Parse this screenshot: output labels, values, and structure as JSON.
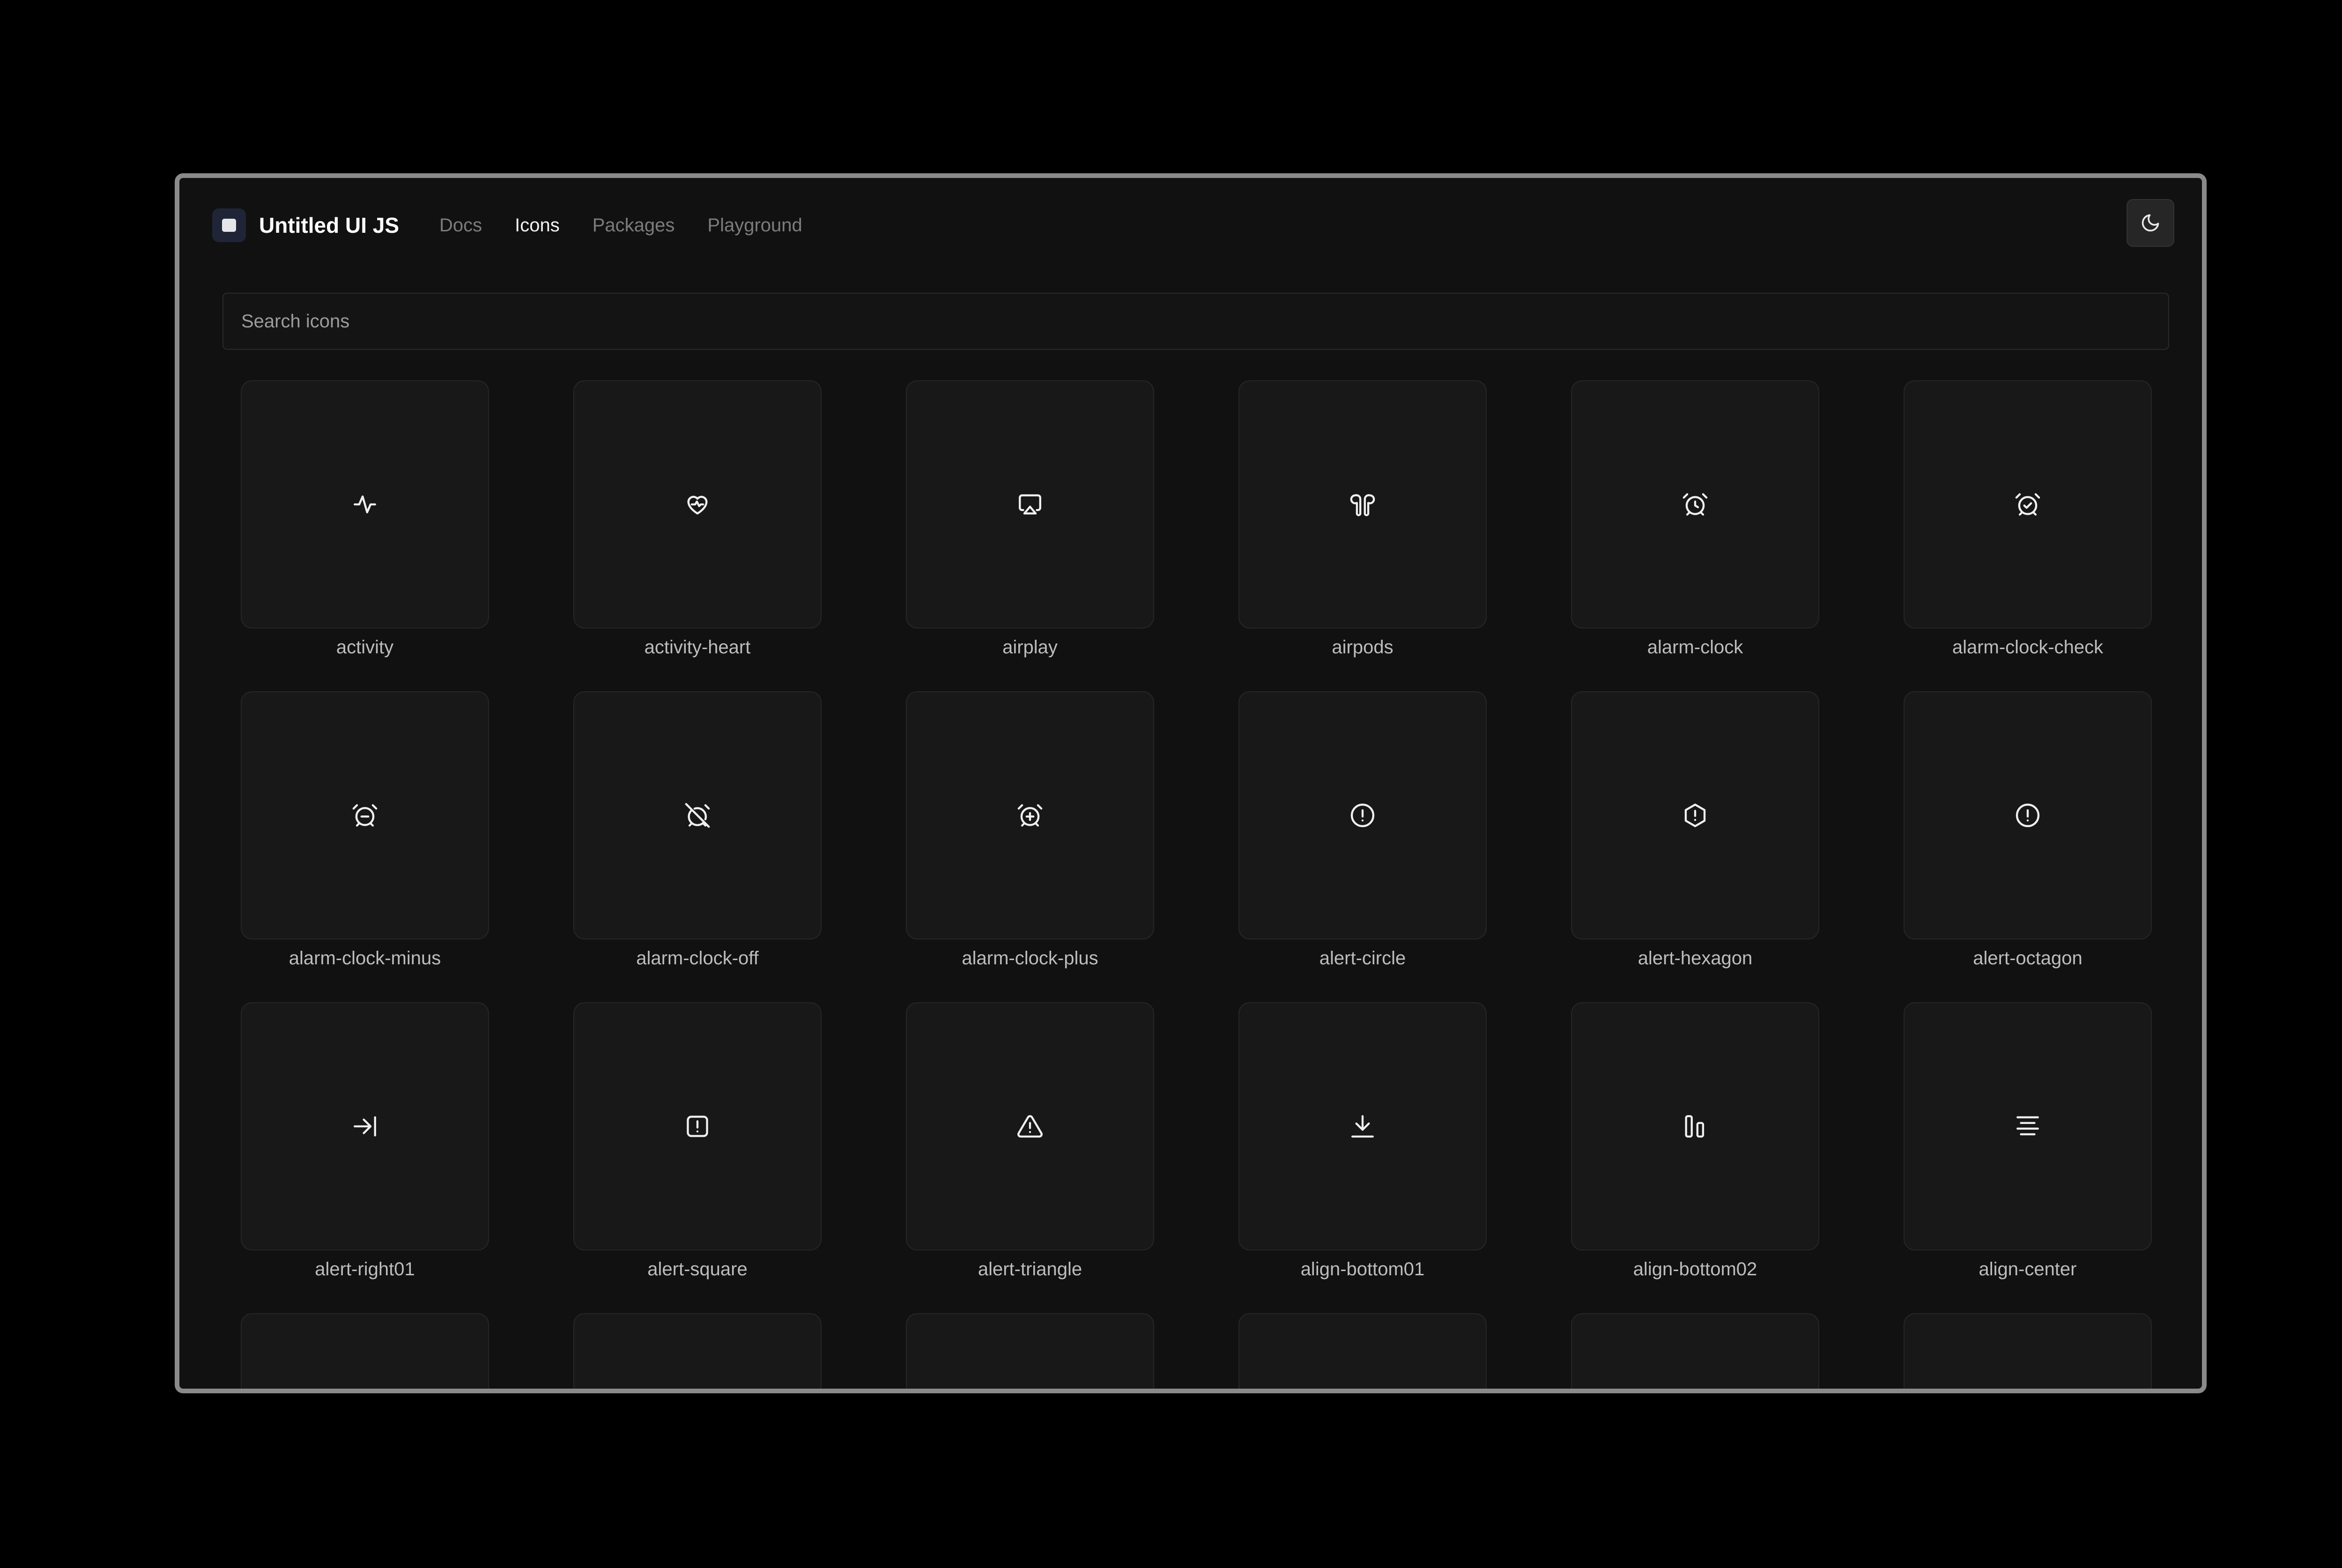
{
  "app": {
    "brand": "Untitled UI JS"
  },
  "nav": [
    {
      "label": "Docs",
      "active": false
    },
    {
      "label": "Icons",
      "active": true
    },
    {
      "label": "Packages",
      "active": false
    },
    {
      "label": "Playground",
      "active": false
    }
  ],
  "theme_toggle": {
    "icon": "moon-icon"
  },
  "search": {
    "placeholder": "Search icons",
    "value": ""
  },
  "icons": [
    {
      "name": "activity",
      "icon": "activity-icon"
    },
    {
      "name": "activity-heart",
      "icon": "activity-heart-icon"
    },
    {
      "name": "airplay",
      "icon": "airplay-icon"
    },
    {
      "name": "airpods",
      "icon": "airpods-icon"
    },
    {
      "name": "alarm-clock",
      "icon": "alarm-clock-icon"
    },
    {
      "name": "alarm-clock-check",
      "icon": "alarm-clock-check-icon"
    },
    {
      "name": "alarm-clock-minus",
      "icon": "alarm-clock-minus-icon"
    },
    {
      "name": "alarm-clock-off",
      "icon": "alarm-clock-off-icon"
    },
    {
      "name": "alarm-clock-plus",
      "icon": "alarm-clock-plus-icon"
    },
    {
      "name": "alert-circle",
      "icon": "alert-circle-icon"
    },
    {
      "name": "alert-hexagon",
      "icon": "alert-hexagon-icon"
    },
    {
      "name": "alert-octagon",
      "icon": "alert-octagon-icon"
    },
    {
      "name": "alert-right01",
      "icon": "alert-right01-icon"
    },
    {
      "name": "alert-square",
      "icon": "alert-square-icon"
    },
    {
      "name": "alert-triangle",
      "icon": "alert-triangle-icon"
    },
    {
      "name": "align-bottom01",
      "icon": "align-bottom01-icon"
    },
    {
      "name": "align-bottom02",
      "icon": "align-bottom02-icon"
    },
    {
      "name": "align-center",
      "icon": "align-center-icon"
    }
  ],
  "partial_row_count": 6
}
